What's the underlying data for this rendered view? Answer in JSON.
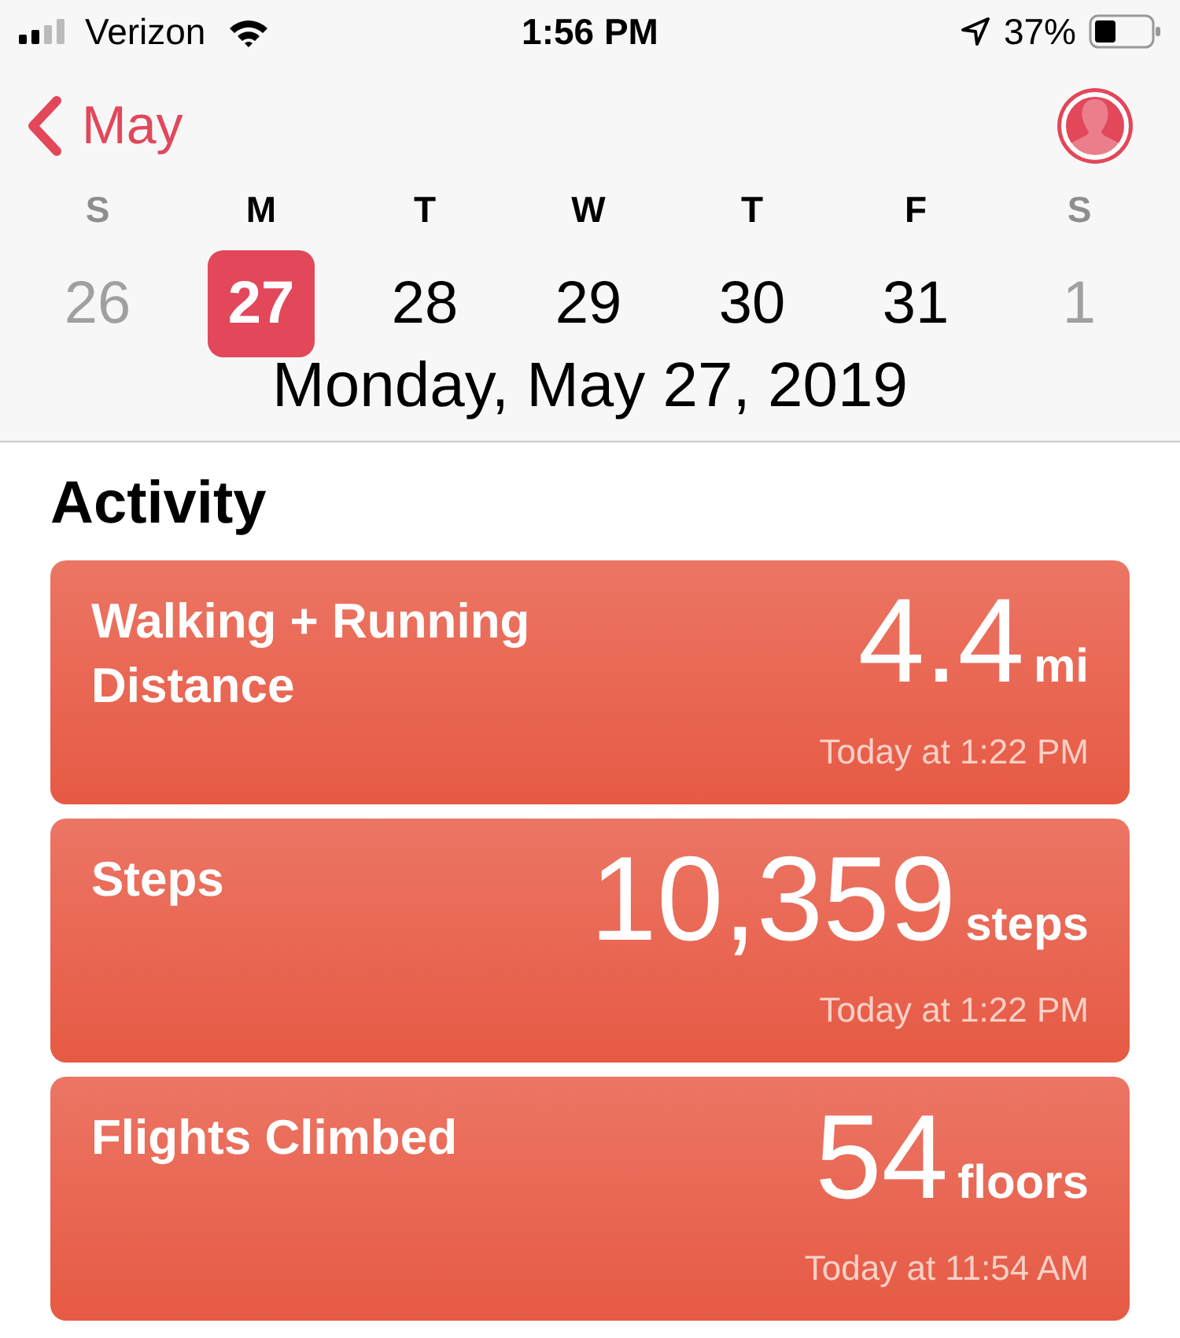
{
  "status_bar": {
    "carrier": "Verizon",
    "time": "1:56 PM",
    "battery": "37%"
  },
  "nav": {
    "back_label": "May"
  },
  "week": [
    {
      "weekday": "S",
      "date": "26",
      "weekend": true,
      "selected": false
    },
    {
      "weekday": "M",
      "date": "27",
      "weekend": false,
      "selected": true
    },
    {
      "weekday": "T",
      "date": "28",
      "weekend": false,
      "selected": false
    },
    {
      "weekday": "W",
      "date": "29",
      "weekend": false,
      "selected": false
    },
    {
      "weekday": "T",
      "date": "30",
      "weekend": false,
      "selected": false
    },
    {
      "weekday": "F",
      "date": "31",
      "weekend": false,
      "selected": false
    },
    {
      "weekday": "S",
      "date": "1",
      "weekend": true,
      "selected": false
    }
  ],
  "selected_date": "Monday, May 27, 2019",
  "section_title": "Activity",
  "cards": [
    {
      "title": "Walking + Running Distance",
      "value": "4.4",
      "unit": "mi",
      "time": "Today at 1:22 PM"
    },
    {
      "title": "Steps",
      "value": "10,359",
      "unit": "steps",
      "time": "Today at 1:22 PM"
    },
    {
      "title": "Flights Climbed",
      "value": "54",
      "unit": "floors",
      "time": "Today at 11:54 AM"
    }
  ]
}
